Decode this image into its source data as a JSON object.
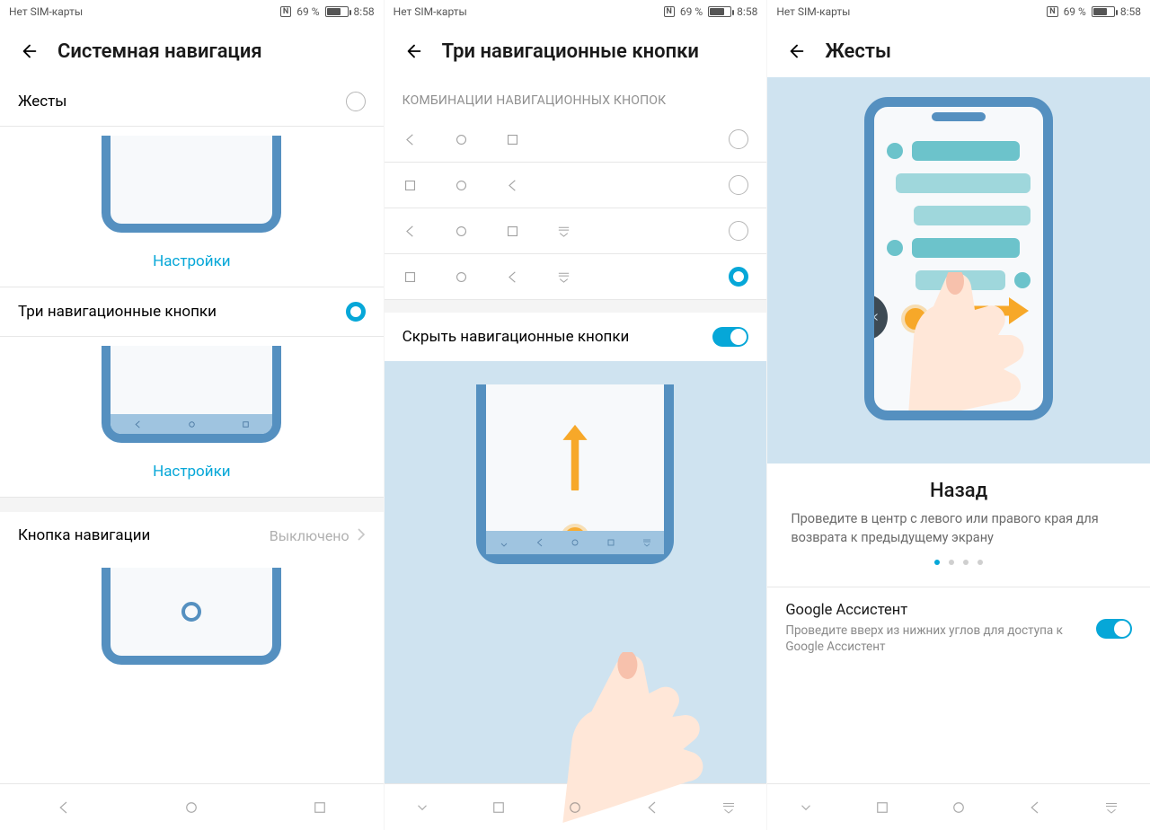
{
  "status": {
    "sim": "Нет SIM-карты",
    "pct": "69 %",
    "time": "8:58"
  },
  "pane1": {
    "title": "Системная навигация",
    "opt1": {
      "label": "Жесты",
      "settings": "Настройки"
    },
    "opt2": {
      "label": "Три навигационные кнопки",
      "settings": "Настройки"
    },
    "opt3": {
      "label": "Кнопка навигации",
      "state": "Выключено"
    }
  },
  "pane2": {
    "title": "Три навигационные кнопки",
    "section": "КОМБИНАЦИИ НАВИГАЦИОННЫХ КНОПОК",
    "hide": {
      "label": "Скрыть навигационные кнопки"
    }
  },
  "pane3": {
    "title": "Жесты",
    "card": {
      "title": "Назад",
      "desc": "Проведите в центр с левого или правого края для возврата к предыдущему экрану"
    },
    "ga": {
      "title": "Google Ассистент",
      "desc": "Проведите вверх из нижних углов для доступа к Google Ассистент"
    }
  }
}
